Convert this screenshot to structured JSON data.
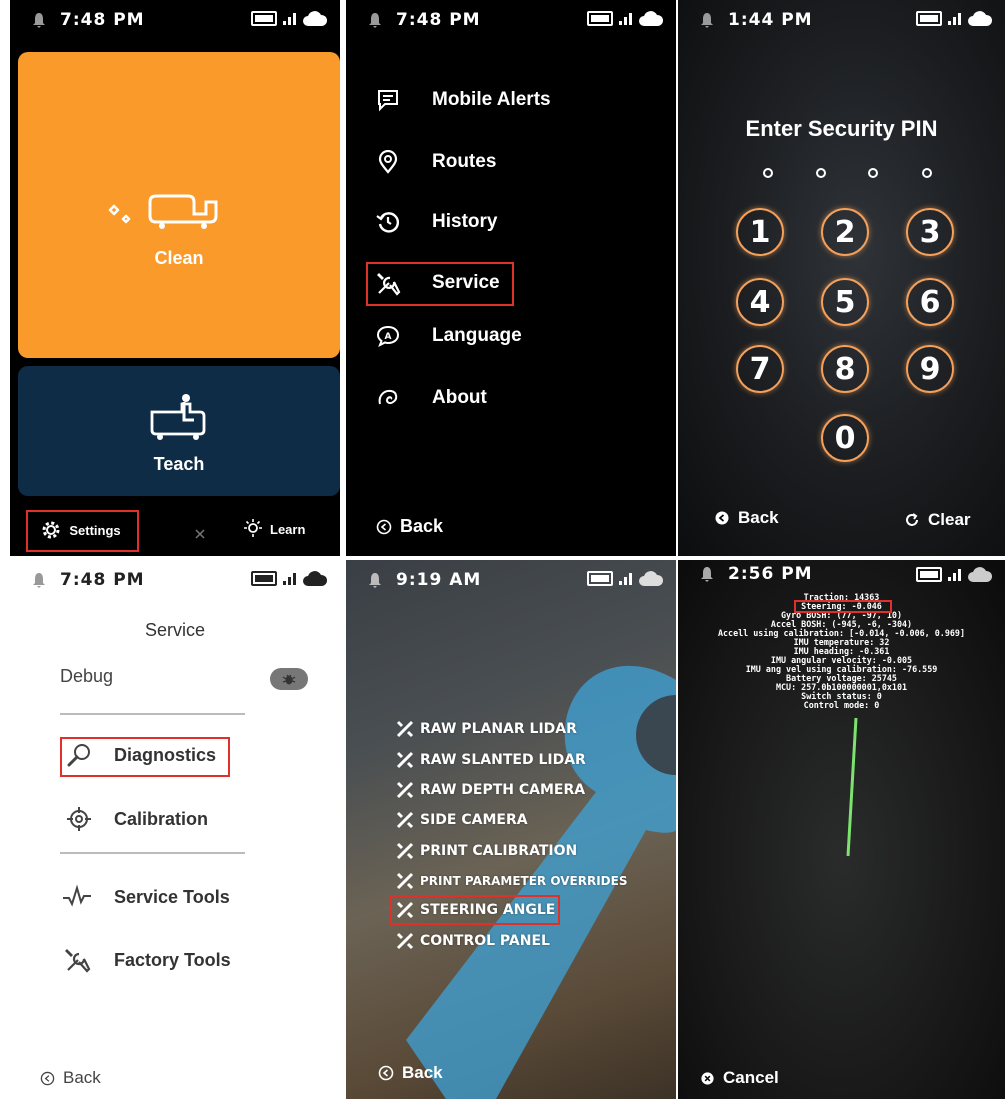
{
  "panel1": {
    "time": "7:48 PM",
    "clean_label": "Clean",
    "teach_label": "Teach",
    "settings_label": "Settings",
    "learn_label": "Learn",
    "colors": {
      "clean": "#f99a2a",
      "teach": "#0f2c47",
      "background": "#000000",
      "highlight": "#e0302a"
    }
  },
  "panel2": {
    "time": "7:48 PM",
    "menu": [
      {
        "label": "Mobile Alerts",
        "icon": "chat-alert-icon"
      },
      {
        "label": "Routes",
        "icon": "location-pin-icon"
      },
      {
        "label": "History",
        "icon": "history-icon"
      },
      {
        "label": "Service",
        "icon": "wrench-screwdriver-icon"
      },
      {
        "label": "Language",
        "icon": "language-bubble-icon"
      },
      {
        "label": "About",
        "icon": "about-swirl-icon"
      }
    ],
    "back_label": "Back"
  },
  "panel3": {
    "time": "1:44 PM",
    "title": "Enter Security PIN",
    "keys": [
      "1",
      "2",
      "3",
      "4",
      "5",
      "6",
      "7",
      "8",
      "9",
      "0"
    ],
    "back_label": "Back",
    "clear_label": "Clear"
  },
  "panel4": {
    "time": "7:48 PM",
    "title": "Service",
    "debug_label": "Debug",
    "items": [
      {
        "label": "Diagnostics",
        "icon": "magnifier-icon"
      },
      {
        "label": "Calibration",
        "icon": "crosshair-icon"
      },
      {
        "label": "Service Tools",
        "icon": "pulse-icon"
      },
      {
        "label": "Factory Tools",
        "icon": "tools-icon"
      }
    ],
    "back_label": "Back"
  },
  "panel5": {
    "time": "9:19 AM",
    "items": [
      "RAW PLANAR LIDAR",
      "RAW SLANTED LIDAR",
      "RAW DEPTH CAMERA",
      "SIDE CAMERA",
      "PRINT CALIBRATION",
      "PRINT PARAMETER OVERRIDES",
      "STEERING ANGLE",
      "CONTROL PANEL"
    ],
    "back_label": "Back"
  },
  "panel6": {
    "time": "2:56 PM",
    "telemetry": [
      "Traction: 14363",
      "Steering: -0.046",
      "Gyro BOSH: (77, -97, 10)",
      "Accel BOSH: (-945, -6, -304)",
      "Accell using calibration: [-0.014, -0.006, 0.969]",
      "IMU temperature: 32",
      "IMU heading: -0.361",
      "IMU angular velocity: -0.005",
      "IMU ang vel using calibration: -76.559",
      "Battery voltage: 25745",
      "MCU: 257.0b100000001,0x101",
      "Switch status: 0",
      "Control mode: 0"
    ],
    "cancel_label": "Cancel"
  }
}
